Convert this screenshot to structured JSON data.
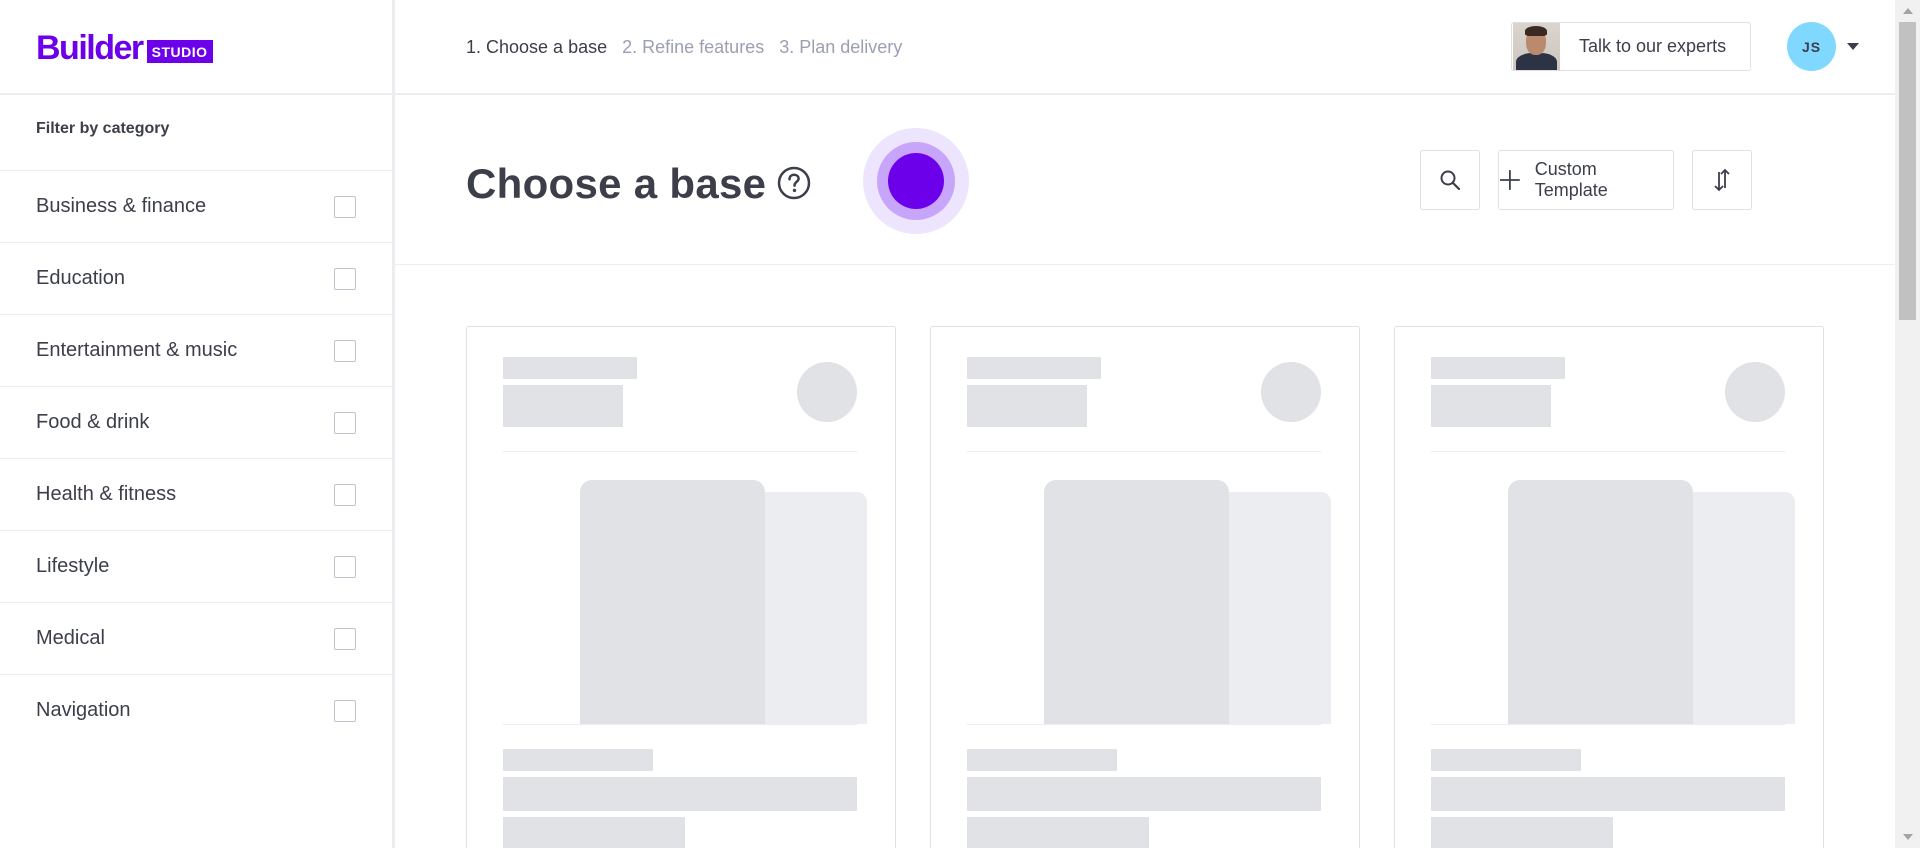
{
  "header": {
    "logo_word": "Builder",
    "logo_badge": "STUDIO",
    "steps": [
      {
        "label": "1. Choose a base",
        "active": true
      },
      {
        "label": "2. Refine features",
        "active": false
      },
      {
        "label": "3. Plan delivery",
        "active": false
      }
    ],
    "expert_button_label": "Talk to our experts",
    "user_initials": "JS"
  },
  "sidebar": {
    "filter_title": "Filter by category",
    "categories": [
      {
        "label": "Business & finance",
        "checked": false
      },
      {
        "label": "Education",
        "checked": false
      },
      {
        "label": "Entertainment & music",
        "checked": false
      },
      {
        "label": "Food & drink",
        "checked": false
      },
      {
        "label": "Health & fitness",
        "checked": false
      },
      {
        "label": "Lifestyle",
        "checked": false
      },
      {
        "label": "Medical",
        "checked": false
      },
      {
        "label": "Navigation",
        "checked": false
      }
    ]
  },
  "main": {
    "title": "Choose a base",
    "custom_template_label": "Custom Template",
    "icons": {
      "help": "help-circle-icon",
      "search": "search-icon",
      "plus": "plus-icon",
      "sort": "sort-icon"
    },
    "cards_loading": 3
  },
  "colors": {
    "brand": "#6c00ea",
    "text": "#3c3e49",
    "muted": "#9b9fb1",
    "skeleton": "#e1e2e6",
    "avatar_bg": "#80d8ff"
  }
}
